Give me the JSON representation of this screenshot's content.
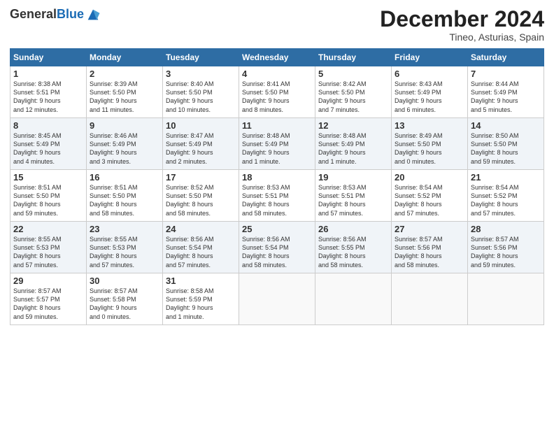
{
  "logo": {
    "general": "General",
    "blue": "Blue"
  },
  "title": "December 2024",
  "location": "Tineo, Asturias, Spain",
  "headers": [
    "Sunday",
    "Monday",
    "Tuesday",
    "Wednesday",
    "Thursday",
    "Friday",
    "Saturday"
  ],
  "weeks": [
    [
      {
        "day": "1",
        "lines": [
          "Sunrise: 8:38 AM",
          "Sunset: 5:51 PM",
          "Daylight: 9 hours",
          "and 12 minutes."
        ]
      },
      {
        "day": "2",
        "lines": [
          "Sunrise: 8:39 AM",
          "Sunset: 5:50 PM",
          "Daylight: 9 hours",
          "and 11 minutes."
        ]
      },
      {
        "day": "3",
        "lines": [
          "Sunrise: 8:40 AM",
          "Sunset: 5:50 PM",
          "Daylight: 9 hours",
          "and 10 minutes."
        ]
      },
      {
        "day": "4",
        "lines": [
          "Sunrise: 8:41 AM",
          "Sunset: 5:50 PM",
          "Daylight: 9 hours",
          "and 8 minutes."
        ]
      },
      {
        "day": "5",
        "lines": [
          "Sunrise: 8:42 AM",
          "Sunset: 5:50 PM",
          "Daylight: 9 hours",
          "and 7 minutes."
        ]
      },
      {
        "day": "6",
        "lines": [
          "Sunrise: 8:43 AM",
          "Sunset: 5:49 PM",
          "Daylight: 9 hours",
          "and 6 minutes."
        ]
      },
      {
        "day": "7",
        "lines": [
          "Sunrise: 8:44 AM",
          "Sunset: 5:49 PM",
          "Daylight: 9 hours",
          "and 5 minutes."
        ]
      }
    ],
    [
      {
        "day": "8",
        "lines": [
          "Sunrise: 8:45 AM",
          "Sunset: 5:49 PM",
          "Daylight: 9 hours",
          "and 4 minutes."
        ]
      },
      {
        "day": "9",
        "lines": [
          "Sunrise: 8:46 AM",
          "Sunset: 5:49 PM",
          "Daylight: 9 hours",
          "and 3 minutes."
        ]
      },
      {
        "day": "10",
        "lines": [
          "Sunrise: 8:47 AM",
          "Sunset: 5:49 PM",
          "Daylight: 9 hours",
          "and 2 minutes."
        ]
      },
      {
        "day": "11",
        "lines": [
          "Sunrise: 8:48 AM",
          "Sunset: 5:49 PM",
          "Daylight: 9 hours",
          "and 1 minute."
        ]
      },
      {
        "day": "12",
        "lines": [
          "Sunrise: 8:48 AM",
          "Sunset: 5:49 PM",
          "Daylight: 9 hours",
          "and 1 minute."
        ]
      },
      {
        "day": "13",
        "lines": [
          "Sunrise: 8:49 AM",
          "Sunset: 5:50 PM",
          "Daylight: 9 hours",
          "and 0 minutes."
        ]
      },
      {
        "day": "14",
        "lines": [
          "Sunrise: 8:50 AM",
          "Sunset: 5:50 PM",
          "Daylight: 8 hours",
          "and 59 minutes."
        ]
      }
    ],
    [
      {
        "day": "15",
        "lines": [
          "Sunrise: 8:51 AM",
          "Sunset: 5:50 PM",
          "Daylight: 8 hours",
          "and 59 minutes."
        ]
      },
      {
        "day": "16",
        "lines": [
          "Sunrise: 8:51 AM",
          "Sunset: 5:50 PM",
          "Daylight: 8 hours",
          "and 58 minutes."
        ]
      },
      {
        "day": "17",
        "lines": [
          "Sunrise: 8:52 AM",
          "Sunset: 5:50 PM",
          "Daylight: 8 hours",
          "and 58 minutes."
        ]
      },
      {
        "day": "18",
        "lines": [
          "Sunrise: 8:53 AM",
          "Sunset: 5:51 PM",
          "Daylight: 8 hours",
          "and 58 minutes."
        ]
      },
      {
        "day": "19",
        "lines": [
          "Sunrise: 8:53 AM",
          "Sunset: 5:51 PM",
          "Daylight: 8 hours",
          "and 57 minutes."
        ]
      },
      {
        "day": "20",
        "lines": [
          "Sunrise: 8:54 AM",
          "Sunset: 5:52 PM",
          "Daylight: 8 hours",
          "and 57 minutes."
        ]
      },
      {
        "day": "21",
        "lines": [
          "Sunrise: 8:54 AM",
          "Sunset: 5:52 PM",
          "Daylight: 8 hours",
          "and 57 minutes."
        ]
      }
    ],
    [
      {
        "day": "22",
        "lines": [
          "Sunrise: 8:55 AM",
          "Sunset: 5:53 PM",
          "Daylight: 8 hours",
          "and 57 minutes."
        ]
      },
      {
        "day": "23",
        "lines": [
          "Sunrise: 8:55 AM",
          "Sunset: 5:53 PM",
          "Daylight: 8 hours",
          "and 57 minutes."
        ]
      },
      {
        "day": "24",
        "lines": [
          "Sunrise: 8:56 AM",
          "Sunset: 5:54 PM",
          "Daylight: 8 hours",
          "and 57 minutes."
        ]
      },
      {
        "day": "25",
        "lines": [
          "Sunrise: 8:56 AM",
          "Sunset: 5:54 PM",
          "Daylight: 8 hours",
          "and 58 minutes."
        ]
      },
      {
        "day": "26",
        "lines": [
          "Sunrise: 8:56 AM",
          "Sunset: 5:55 PM",
          "Daylight: 8 hours",
          "and 58 minutes."
        ]
      },
      {
        "day": "27",
        "lines": [
          "Sunrise: 8:57 AM",
          "Sunset: 5:56 PM",
          "Daylight: 8 hours",
          "and 58 minutes."
        ]
      },
      {
        "day": "28",
        "lines": [
          "Sunrise: 8:57 AM",
          "Sunset: 5:56 PM",
          "Daylight: 8 hours",
          "and 59 minutes."
        ]
      }
    ],
    [
      {
        "day": "29",
        "lines": [
          "Sunrise: 8:57 AM",
          "Sunset: 5:57 PM",
          "Daylight: 8 hours",
          "and 59 minutes."
        ]
      },
      {
        "day": "30",
        "lines": [
          "Sunrise: 8:57 AM",
          "Sunset: 5:58 PM",
          "Daylight: 9 hours",
          "and 0 minutes."
        ]
      },
      {
        "day": "31",
        "lines": [
          "Sunrise: 8:58 AM",
          "Sunset: 5:59 PM",
          "Daylight: 9 hours",
          "and 1 minute."
        ]
      },
      null,
      null,
      null,
      null
    ]
  ]
}
